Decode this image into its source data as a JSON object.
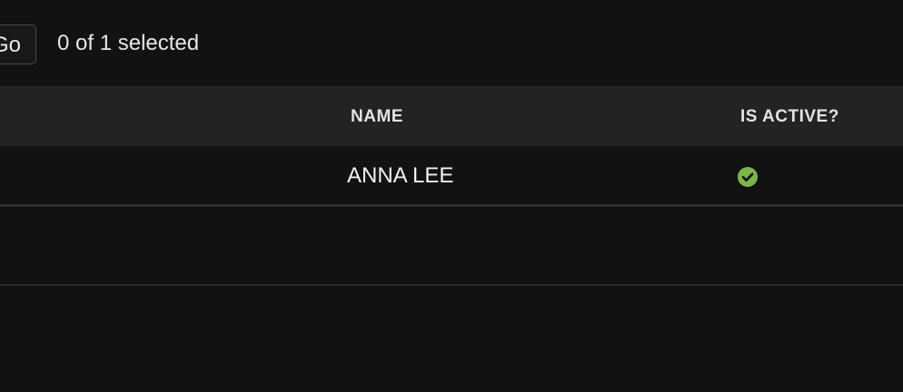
{
  "actions": {
    "go_label": "Go",
    "selection_counter": "0 of 1 selected"
  },
  "table": {
    "columns": {
      "name": "NAME",
      "is_active": "IS ACTIVE?"
    },
    "rows": [
      {
        "name": "ANNA LEE",
        "is_active_icon": "check-circle-icon",
        "is_active_color": "#7ab648"
      }
    ]
  }
}
